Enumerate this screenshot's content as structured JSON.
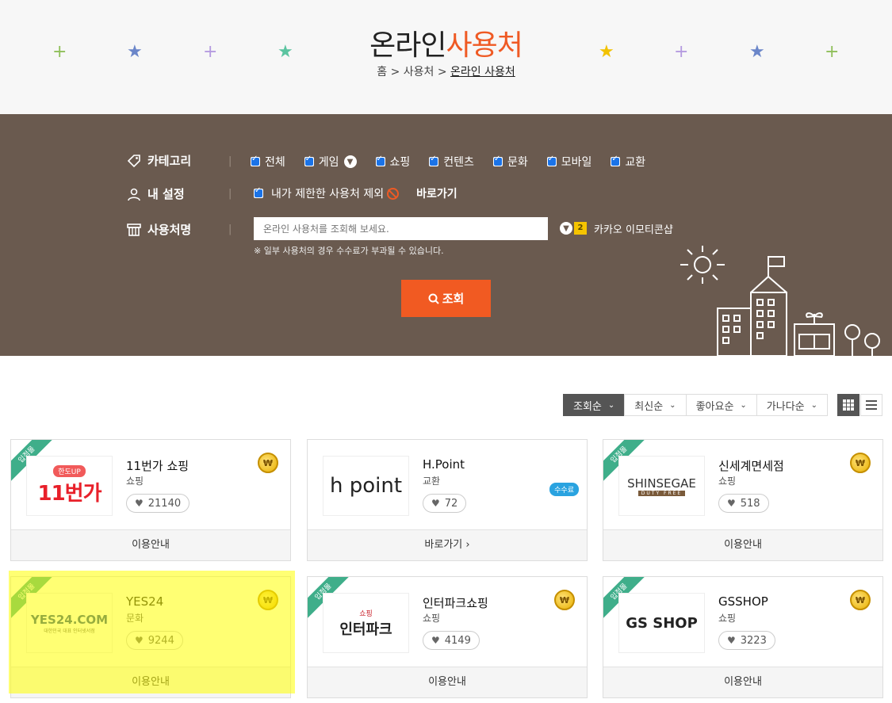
{
  "header": {
    "title_part1": "온라인",
    "title_part2": "사용처",
    "breadcrumb": {
      "home": "홈",
      "sep": ">",
      "level1": "사용처",
      "current": "온라인 사용처"
    }
  },
  "search": {
    "category_label": "카테고리",
    "categories": [
      {
        "label": "전체",
        "checked": true
      },
      {
        "label": "게임",
        "checked": true,
        "has_dropdown": true
      },
      {
        "label": "쇼핑",
        "checked": true
      },
      {
        "label": "컨텐츠",
        "checked": true
      },
      {
        "label": "문화",
        "checked": true
      },
      {
        "label": "모바일",
        "checked": true
      },
      {
        "label": "교환",
        "checked": true
      }
    ],
    "my_setting_label": "내 설정",
    "exclude_label": "내가 제한한 사용처 제외",
    "goto_label": "바로가기",
    "name_label": "사용처명",
    "input_placeholder": "온라인 사용처를 조회해 보세요.",
    "kakao_badge": "2",
    "kakao_label": "카카오 이모티콘샵",
    "note": "※ 일부 사용처의 경우 수수료가 부과될 수 있습니다.",
    "search_button": "조회"
  },
  "sort": {
    "options": [
      "조회순",
      "최신순",
      "좋아요순",
      "가나다순"
    ],
    "active": "조회순"
  },
  "cards": [
    {
      "name": "11번가 쇼핑",
      "category": "쇼핑",
      "likes": "21140",
      "ribbon": "입점몰",
      "footer": "이용안내",
      "coin": "₩",
      "logo_text": "11번가",
      "logo_sub": "한도UP"
    },
    {
      "name": "H.Point",
      "category": "교환",
      "likes": "72",
      "ribbon": "",
      "footer": "바로가기  ›",
      "fee": "수수료",
      "logo_text": "h point"
    },
    {
      "name": "신세계면세점",
      "category": "쇼핑",
      "likes": "518",
      "ribbon": "입점몰",
      "footer": "이용안내",
      "coin": "₩",
      "logo_text": "SHINSEGAE",
      "logo_sub": "DUTY FREE"
    },
    {
      "name": "YES24",
      "category": "문화",
      "likes": "9244",
      "ribbon": "입점몰",
      "footer": "이용안내",
      "coin": "₩",
      "logo_text": "YES24.COM",
      "logo_sub": "대한민국 대표 인터넷서점"
    },
    {
      "name": "인터파크쇼핑",
      "category": "쇼핑",
      "likes": "4149",
      "ribbon": "입점몰",
      "footer": "이용안내",
      "coin": "₩",
      "logo_text": "인터파크",
      "logo_sub": "쇼핑"
    },
    {
      "name": "GSSHOP",
      "category": "쇼핑",
      "likes": "3223",
      "ribbon": "입점몰",
      "footer": "이용안내",
      "coin": "₩",
      "logo_text": "GS SHOP"
    }
  ],
  "colors": {
    "accent": "#ef5a24",
    "panel": "#6a5a4f",
    "ribbon": "#3fae8a"
  }
}
